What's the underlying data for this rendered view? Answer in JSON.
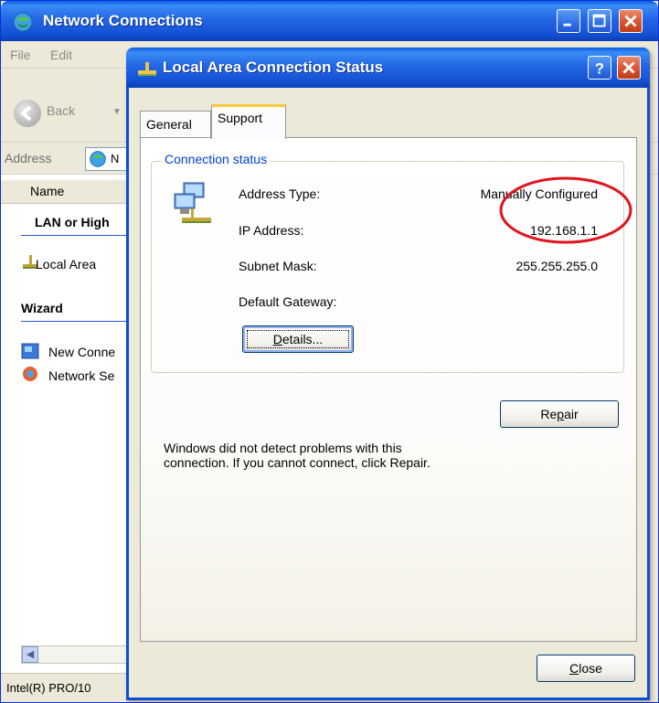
{
  "background_window": {
    "title": "Network Connections",
    "menu": [
      "File",
      "Edit"
    ],
    "back_label": "Back",
    "address_label": "Address",
    "address_value": "N",
    "column_header": "Name",
    "groups": [
      {
        "title": "LAN or High",
        "items": [
          "Local Area"
        ]
      },
      {
        "title": "Wizard",
        "items": [
          "New Conne",
          "Network Se"
        ]
      }
    ],
    "status_text": "Intel(R) PRO/10"
  },
  "dialog": {
    "title": "Local Area Connection Status",
    "tabs": [
      {
        "label": "General",
        "active": false
      },
      {
        "label": "Support",
        "active": true
      }
    ],
    "groupbox_title": "Connection status",
    "fields": [
      {
        "label": "Address Type:",
        "value": "Manually Configured"
      },
      {
        "label": "IP Address:",
        "value": "192.168.1.1"
      },
      {
        "label": "Subnet Mask:",
        "value": "255.255.255.0"
      },
      {
        "label": "Default Gateway:",
        "value": ""
      }
    ],
    "details_button": {
      "prefix": "",
      "accel": "D",
      "rest": "etails..."
    },
    "diagnostic_text": "Windows did not detect problems with this connection. If you cannot connect, click Repair.",
    "repair_button": {
      "prefix": "Re",
      "accel": "p",
      "rest": "air"
    },
    "close_button": {
      "prefix": "",
      "accel": "C",
      "rest": "lose"
    }
  },
  "annotation": {
    "color": "#e0141e"
  },
  "colors": {
    "titlebar_blue": "#0b4fd4",
    "close_red": "#d8542f",
    "group_title": "#0046d5",
    "tab_highlight": "#ffc73c"
  }
}
